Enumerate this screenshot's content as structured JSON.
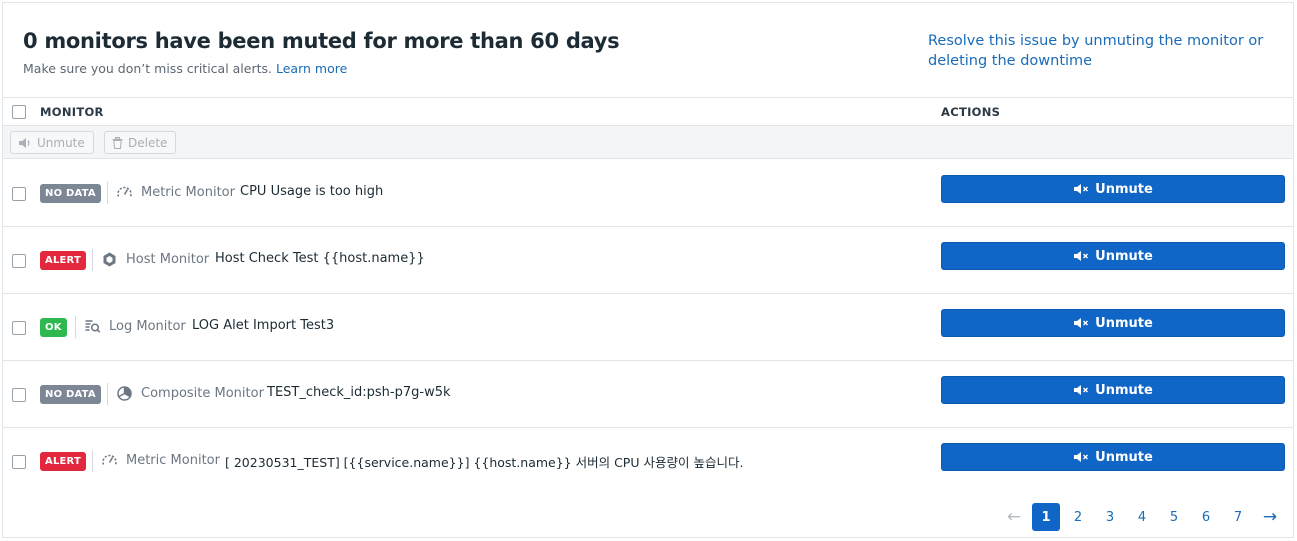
{
  "header": {
    "title": "0 monitors have been muted for more than 60 days",
    "subtitle": "Make sure you don’t miss critical alerts.",
    "learn_more": "Learn more",
    "resolve_link": "Resolve this issue by unmuting the monitor or deleting the downtime"
  },
  "table": {
    "col_monitor": "MONITOR",
    "col_actions": "ACTIONS",
    "bulk_unmute": "Unmute",
    "bulk_delete": "Delete",
    "rows": [
      {
        "status": "NO DATA",
        "status_kind": "nodata",
        "type": "Metric Monitor",
        "icon": "metric-gauge-icon",
        "name": "CPU Usage is too high",
        "action": "Unmute"
      },
      {
        "status": "ALERT",
        "status_kind": "alert",
        "type": "Host Monitor",
        "icon": "host-hexagon-icon",
        "name": "Host Check Test {{host.name}}",
        "action": "Unmute"
      },
      {
        "status": "OK",
        "status_kind": "ok",
        "type": "Log Monitor",
        "icon": "log-search-icon",
        "name": "LOG Alet Import Test3",
        "action": "Unmute"
      },
      {
        "status": "NO DATA",
        "status_kind": "nodata",
        "type": "Composite Monitor",
        "icon": "composite-icon",
        "name": "TEST_check_id:psh-p7g-w5k",
        "action": "Unmute"
      },
      {
        "status": "ALERT",
        "status_kind": "alert",
        "type": "Metric Monitor",
        "icon": "metric-gauge-icon",
        "name": "[ 20230531_TEST] [{{service.name}}] {{host.name}} 서버의 CPU 사용량이 높습니다.",
        "action": "Unmute"
      }
    ]
  },
  "pagination": {
    "pages": [
      "1",
      "2",
      "3",
      "4",
      "5",
      "6",
      "7"
    ],
    "current": "1"
  },
  "colors": {
    "accent": "#1066c7",
    "alert": "#e3283e",
    "ok": "#2db94e",
    "nodata": "#7c8694"
  }
}
